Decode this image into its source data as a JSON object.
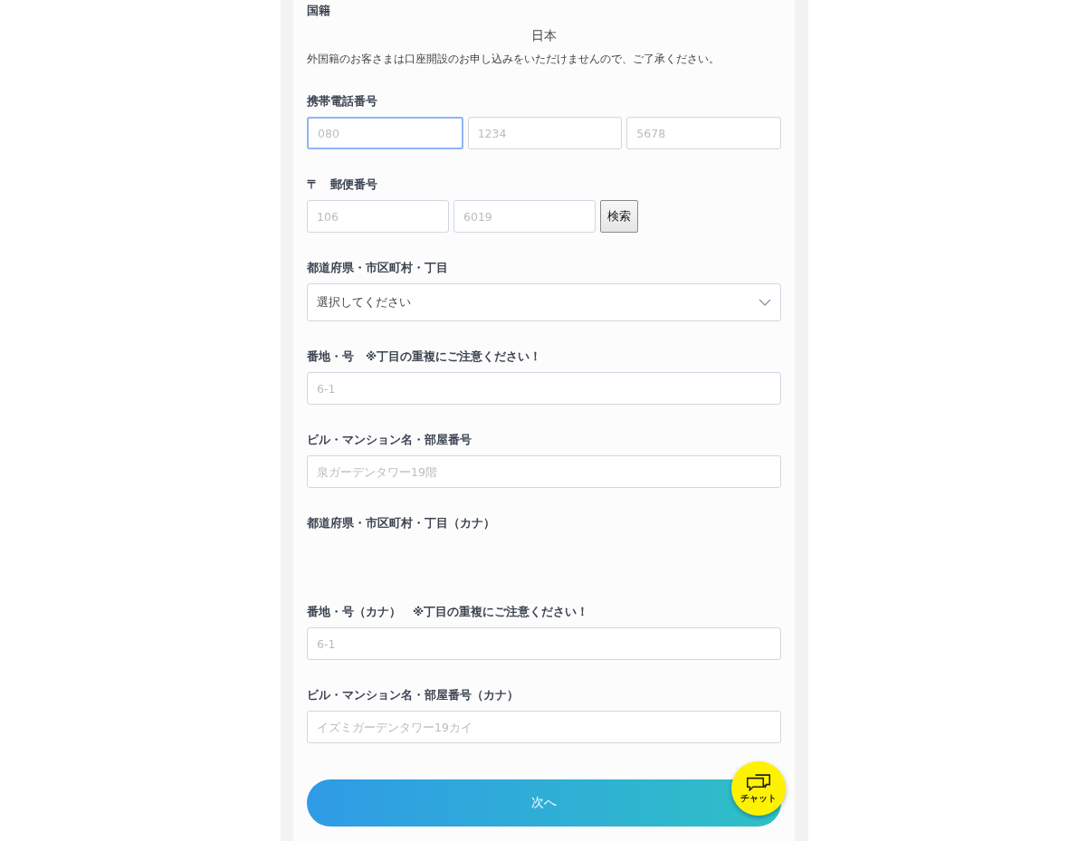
{
  "nationality": {
    "label": "国籍",
    "value": "日本",
    "note": "外国籍のお客さまは口座開設のお申し込みをいただけませんので、ご了承ください。"
  },
  "fields": [
    {
      "kind": "inputs",
      "label": "携帯電話番号",
      "inputs": [
        {
          "placeholder": "080",
          "focused": true
        },
        {
          "placeholder": "1234",
          "focused": false
        },
        {
          "placeholder": "5678",
          "focused": false
        }
      ]
    },
    {
      "kind": "postal",
      "label": "〒　郵便番号",
      "inputs": [
        {
          "placeholder": "106",
          "focused": false
        },
        {
          "placeholder": "6019",
          "focused": false
        }
      ],
      "button": "検索"
    },
    {
      "kind": "select",
      "label": "都道府県・市区町村・丁目",
      "value": "選択してください"
    },
    {
      "kind": "inputs",
      "label": "番地・号　※丁目の重複にご注意ください！",
      "inputs": [
        {
          "placeholder": "6-1",
          "focused": false
        }
      ]
    },
    {
      "kind": "inputs",
      "label": "ビル・マンション名・部屋番号",
      "inputs": [
        {
          "placeholder": "泉ガーデンタワー19階",
          "focused": false
        }
      ]
    },
    {
      "kind": "empty",
      "label": "都道府県・市区町村・丁目（カナ）"
    },
    {
      "kind": "inputs",
      "label": "番地・号（カナ）　※丁目の重複にご注意ください！",
      "inputs": [
        {
          "placeholder": "6-1",
          "focused": false
        }
      ]
    },
    {
      "kind": "inputs",
      "label": "ビル・マンション名・部屋番号（カナ）",
      "inputs": [
        {
          "placeholder": "イズミガーデンタワー19カイ",
          "focused": false
        }
      ]
    }
  ],
  "next_button": "次へ",
  "chat": {
    "label": "チャット"
  }
}
